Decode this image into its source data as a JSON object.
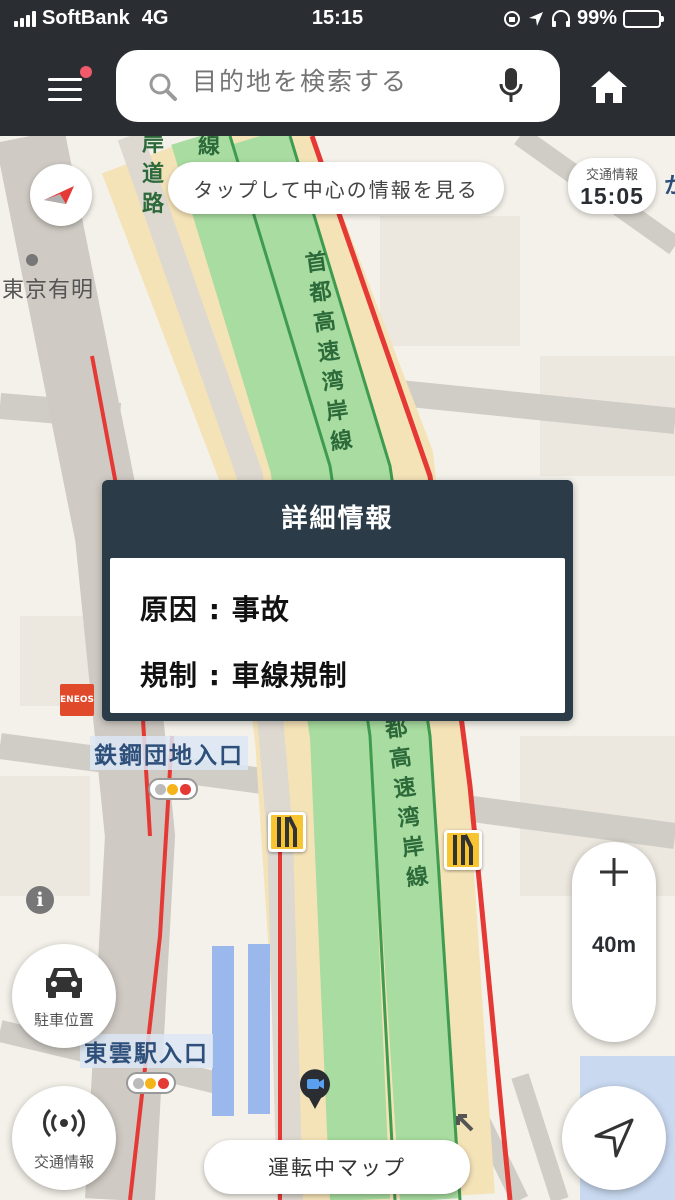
{
  "status_bar": {
    "carrier": "SoftBank",
    "network": "4G",
    "time": "15:15",
    "battery": "99%"
  },
  "header": {
    "search_placeholder": "目的地を検索する",
    "menu_has_notification": true
  },
  "map": {
    "hint": "タップして中心の情報を見る",
    "traffic_info_label": "交通情報",
    "traffic_info_time": "15:05",
    "scale": "40m",
    "labels": {
      "station_tokyo_ariake": "東京有明",
      "tekko_entrance": "鉄鋼団地入口",
      "shinonome_entrance": "東雲駅入口",
      "eneos": "ENEOS",
      "edge_char": "か"
    },
    "road_labels": {
      "expressway_top": "首都高速湾岸線",
      "expressway_bottom": "都高速湾岸線",
      "top_left_1": "岸道路",
      "top_left_2": "線"
    }
  },
  "popup": {
    "title": "詳細情報",
    "rows": [
      "原因 : 事故",
      "規制 : 車線規制"
    ]
  },
  "buttons": {
    "parking": "駐車位置",
    "traffic": "交通情報",
    "driving_map": "運転中マップ"
  },
  "colors": {
    "header_bg": "#2a2e33",
    "popup_header_bg": "#2b3c48",
    "expressway": "#a8dca0",
    "congestion": "#e53935",
    "notification_dot": "#f05a6a"
  },
  "icons": [
    "menu-icon",
    "search-icon",
    "mic-icon",
    "home-icon",
    "compass-icon",
    "car-icon",
    "broadcast-icon",
    "location-arrow-icon",
    "info-icon",
    "lane-restriction-icon",
    "camera-icon"
  ]
}
